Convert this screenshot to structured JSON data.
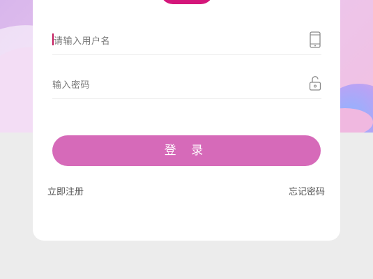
{
  "login_form": {
    "username_placeholder": "请输入用户名",
    "password_placeholder": "输入密码",
    "submit_label": "登 录",
    "register_link": "立即注册",
    "forgot_link": "忘记密码"
  },
  "icons": {
    "username": "mobile-phone-icon",
    "password": "unlock-icon"
  },
  "colors": {
    "accent": "#d66ab9",
    "caret": "#c2185b",
    "brand_blob": "#d4167a",
    "page_background": "#ececec",
    "card_background": "#ffffff"
  }
}
